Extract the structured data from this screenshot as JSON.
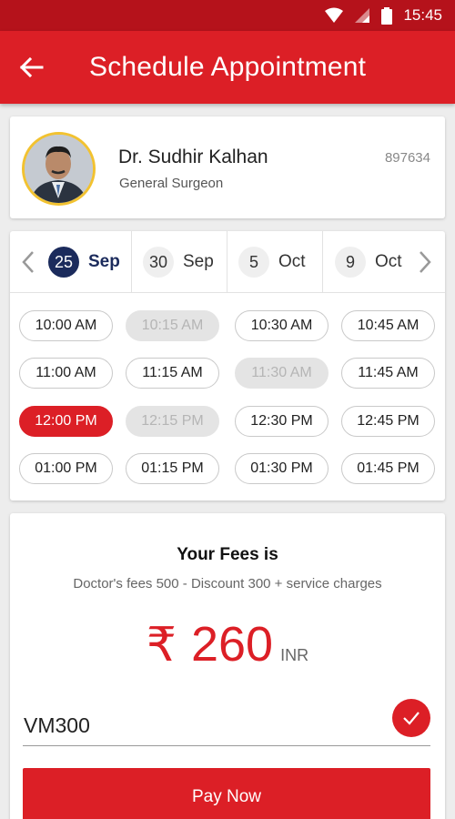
{
  "status_bar": {
    "time": "15:45",
    "icons": [
      "wifi-icon",
      "signal-icon",
      "battery-icon"
    ]
  },
  "app_bar": {
    "title": "Schedule Appointment",
    "back_icon": "arrow-left-icon"
  },
  "doctor": {
    "name": "Dr. Sudhir Kalhan",
    "specialty": "General Surgeon",
    "id": "897634"
  },
  "dates": [
    {
      "day": "25",
      "month": "Sep",
      "selected": true
    },
    {
      "day": "30",
      "month": "Sep",
      "selected": false
    },
    {
      "day": "5",
      "month": "Oct",
      "selected": false
    },
    {
      "day": "9",
      "month": "Oct",
      "selected": false
    }
  ],
  "slots": [
    {
      "time": "10:00 AM",
      "state": "available"
    },
    {
      "time": "10:15 AM",
      "state": "disabled"
    },
    {
      "time": "10:30 AM",
      "state": "available"
    },
    {
      "time": "10:45 AM",
      "state": "available"
    },
    {
      "time": "11:00 AM",
      "state": "available"
    },
    {
      "time": "11:15 AM",
      "state": "available"
    },
    {
      "time": "11:30 AM",
      "state": "disabled"
    },
    {
      "time": "11:45 AM",
      "state": "available"
    },
    {
      "time": "12:00 PM",
      "state": "selected"
    },
    {
      "time": "12:15 PM",
      "state": "disabled"
    },
    {
      "time": "12:30 PM",
      "state": "available"
    },
    {
      "time": "12:45 PM",
      "state": "available"
    },
    {
      "time": "01:00 PM",
      "state": "available"
    },
    {
      "time": "01:15 PM",
      "state": "available"
    },
    {
      "time": "01:30 PM",
      "state": "available"
    },
    {
      "time": "01:45 PM",
      "state": "available"
    }
  ],
  "fees": {
    "title": "Your Fees is",
    "description": "Doctor's fees 500 - Discount 300 + service charges",
    "currency_symbol": "₹",
    "amount": "260",
    "currency": "INR",
    "promo_code": "VM300",
    "pay_label": "Pay Now"
  },
  "colors": {
    "primary": "#dc1f26",
    "status_bar": "#b5121b",
    "selected_date": "#1b2b5c",
    "avatar_ring": "#f2c230"
  }
}
